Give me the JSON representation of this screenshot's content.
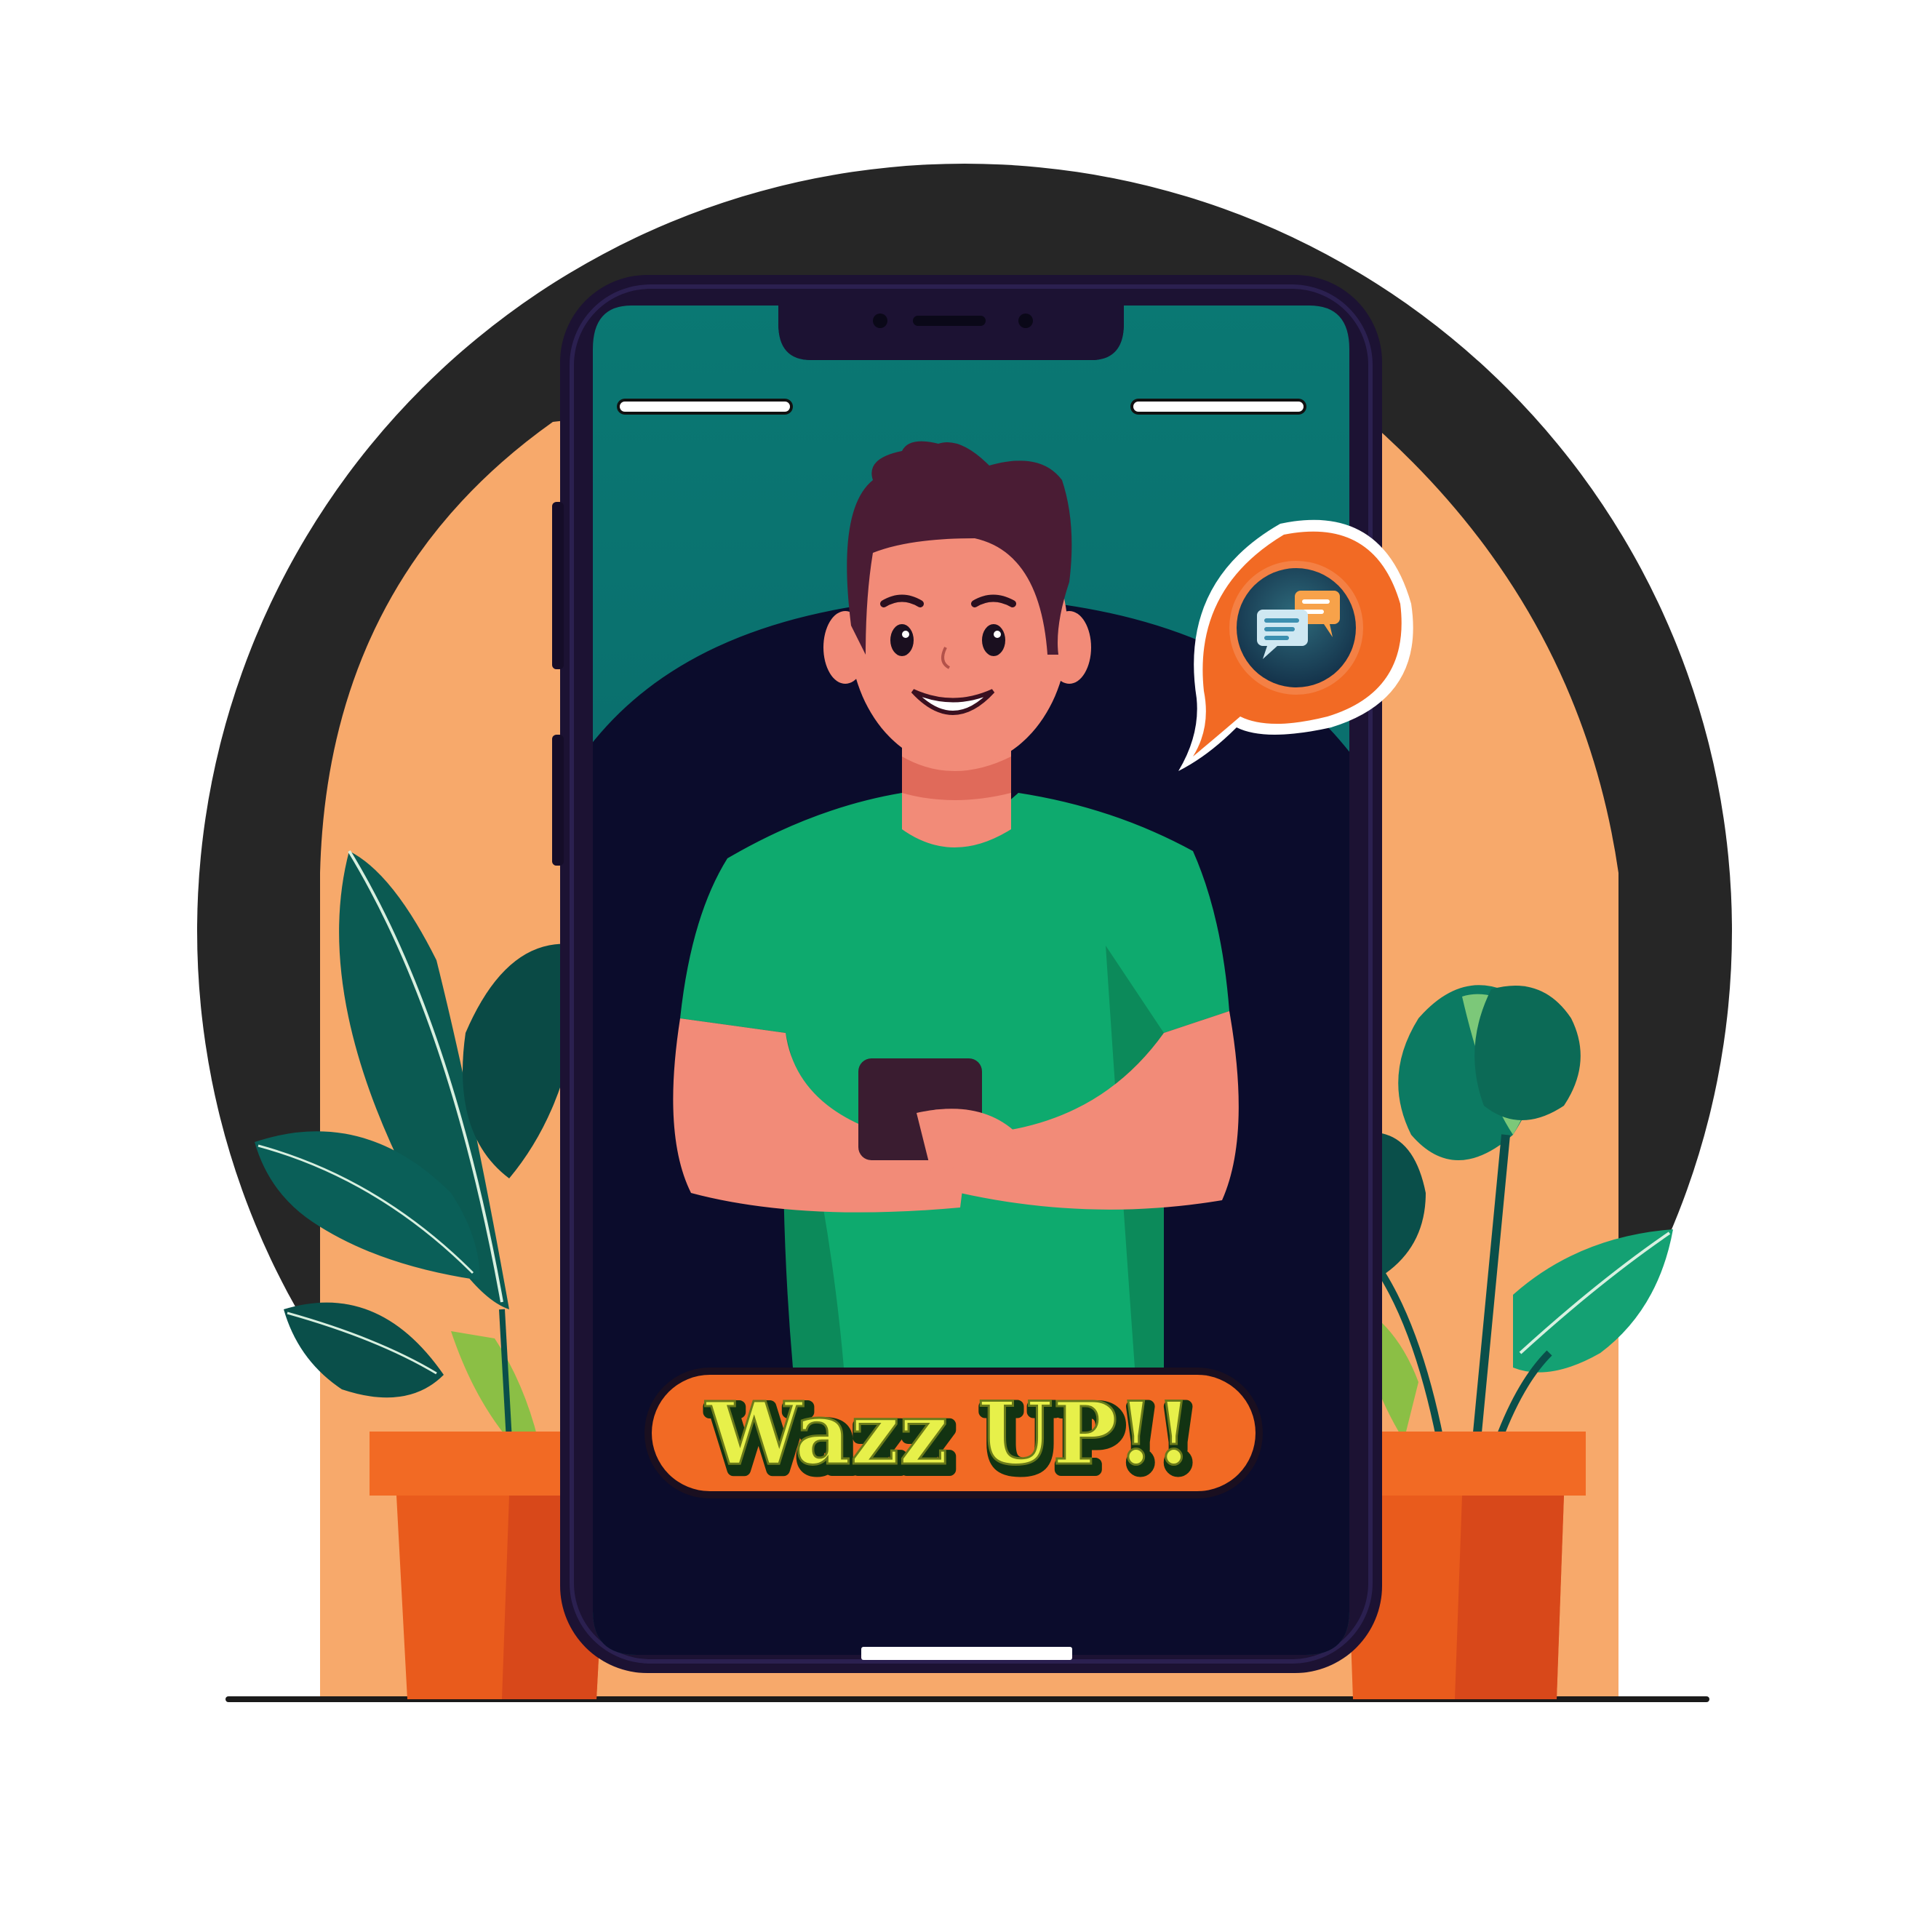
{
  "banner": {
    "text": "Wazz UP!!"
  },
  "colors": {
    "background": "#ffffff",
    "ring": "#262626",
    "orange_backdrop": "#f7a96b",
    "phone_body": "#1c1233",
    "screen_top": "#0a7873",
    "screen_bottom": "#0b0c2c",
    "shirt": "#0eaa6e",
    "skin": "#f28b78",
    "hair": "#4a1c34",
    "leaf_dark": "#0a4f4a",
    "leaf_light": "#14a173",
    "pot": "#f26a24",
    "chat_bubble": "#f26a24",
    "banner_fill": "#f26a24",
    "banner_text": "#e7f04a"
  },
  "icons": {
    "chat": "chat-bubbles-icon"
  }
}
